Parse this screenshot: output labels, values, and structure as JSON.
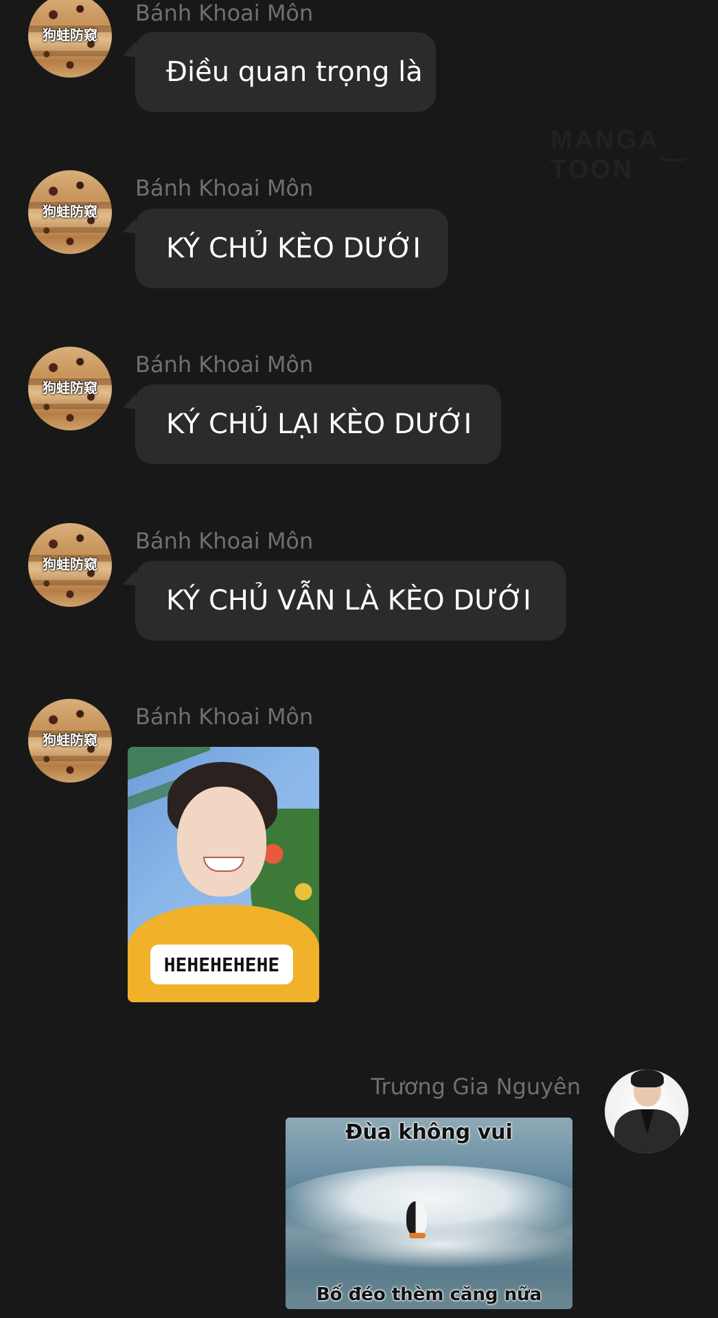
{
  "watermark": "MANGA TOON",
  "messages": [
    {
      "sender": "Bánh Khoai Môn",
      "avatar_caption": "狗蛙防窥",
      "text": "Điều quan trọng là"
    },
    {
      "sender": "Bánh Khoai Môn",
      "avatar_caption": "狗蛙防窥",
      "text": "KÝ CHỦ KÈO DƯỚI"
    },
    {
      "sender": "Bánh Khoai Môn",
      "avatar_caption": "狗蛙防窥",
      "text": "KÝ CHỦ LẠI KÈO DƯỚI"
    },
    {
      "sender": "Bánh Khoai Môn",
      "avatar_caption": "狗蛙防窥",
      "text": "KÝ CHỦ VẪN LÀ KÈO DƯỚI"
    },
    {
      "sender": "Bánh Khoai Môn",
      "avatar_caption": "狗蛙防窥",
      "sticker_caption": "HEHEHEHEHE"
    },
    {
      "sender": "Trương Gia Nguyên",
      "meme_top": "Đùa không vui",
      "meme_bottom": "Bố đéo thèm căng nữa"
    }
  ],
  "icons": {
    "avatar_1": "bread-avatar-icon",
    "avatar_2": "person-avatar-icon"
  }
}
